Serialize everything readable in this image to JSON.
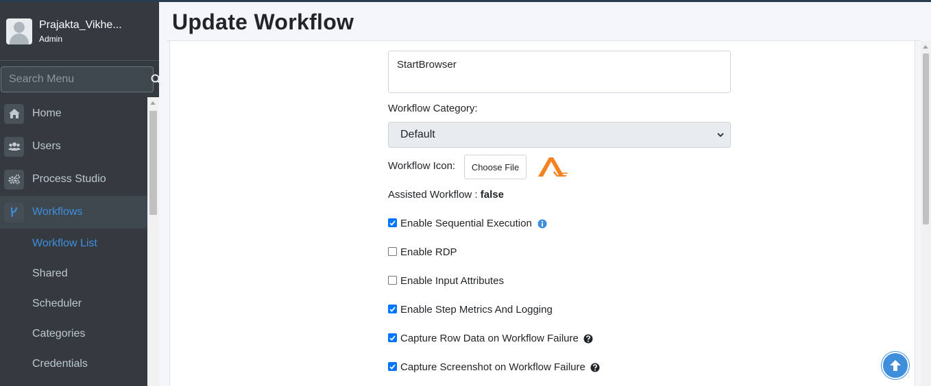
{
  "sidebar": {
    "user": {
      "name": "Prajakta_Vikhe...",
      "role": "Admin"
    },
    "search": {
      "placeholder": "Search Menu"
    },
    "nav": [
      {
        "label": "Home",
        "icon": "home-icon"
      },
      {
        "label": "Users",
        "icon": "users-icon"
      },
      {
        "label": "Process Studio",
        "icon": "gears-icon"
      },
      {
        "label": "Workflows",
        "icon": "workflow-icon"
      }
    ],
    "sub_nav": [
      "Workflow List",
      "Shared",
      "Scheduler",
      "Categories",
      "Credentials"
    ]
  },
  "header": {
    "title": "Update Workflow"
  },
  "form": {
    "description_value": "StartBrowser",
    "category_label": "Workflow Category:",
    "category_selected": "Default",
    "icon_label": "Workflow Icon:",
    "choose_file_label": "Choose File",
    "assisted_label": "Assisted Workflow :",
    "assisted_value": "false",
    "checkboxes": [
      {
        "label": "Enable Sequential Execution",
        "checked": true
      },
      {
        "label": "Enable RDP",
        "checked": false
      },
      {
        "label": "Enable Input Attributes",
        "checked": false
      },
      {
        "label": "Enable Step Metrics And Logging",
        "checked": true
      },
      {
        "label": "Capture Row Data on Workflow Failure",
        "checked": true
      },
      {
        "label": "Capture Screenshot on Workflow Failure",
        "checked": true
      }
    ]
  },
  "colors": {
    "sidebar_bg": "#343a40",
    "accent": "#3f8edc",
    "checkbox": "#0075ff",
    "logo": "#f58220"
  }
}
